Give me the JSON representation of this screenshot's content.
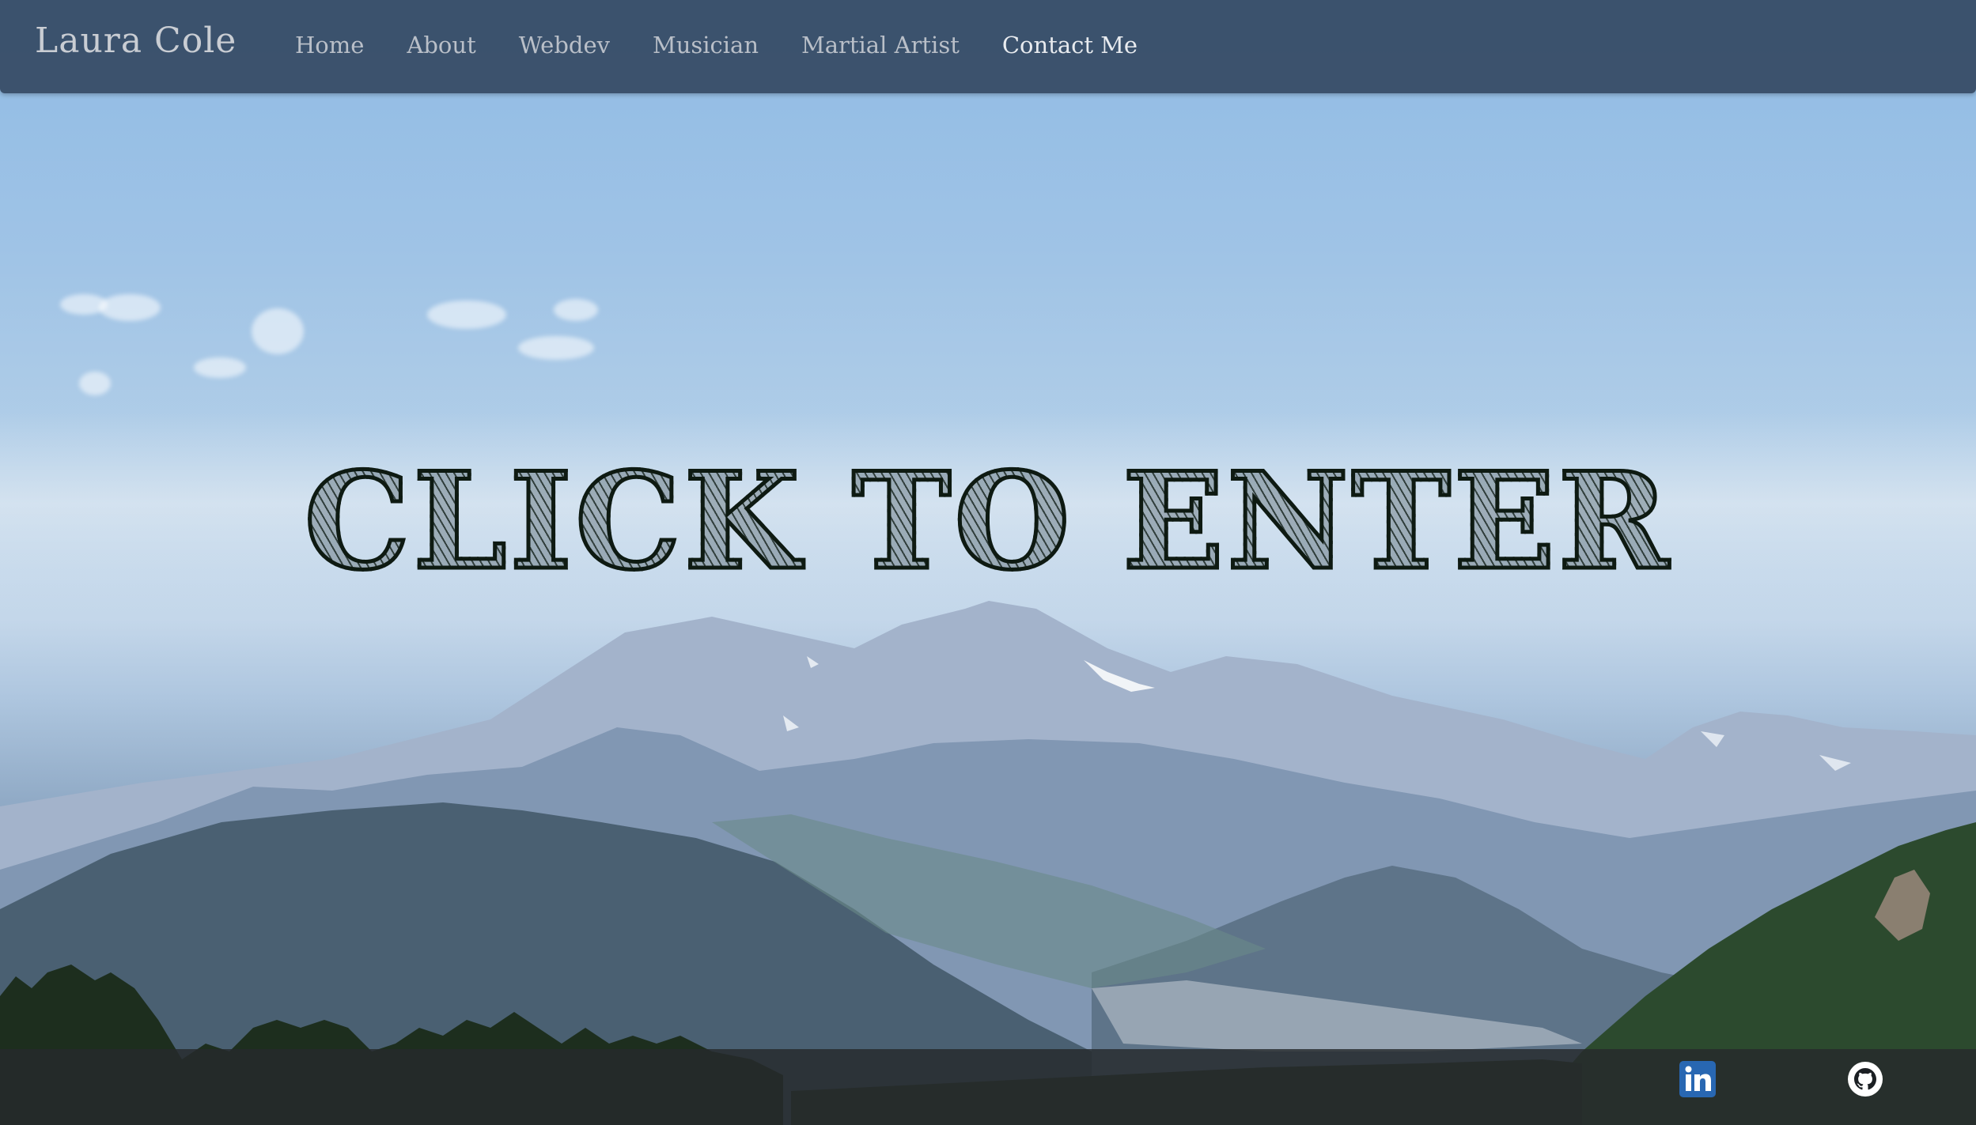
{
  "brand": {
    "name": "Laura Cole"
  },
  "nav": {
    "items": [
      {
        "label": "Home"
      },
      {
        "label": "About"
      },
      {
        "label": "Webdev"
      },
      {
        "label": "Musician"
      },
      {
        "label": "Martial Artist"
      },
      {
        "label": "Contact Me"
      }
    ]
  },
  "hero": {
    "cta": "CLICK TO ENTER"
  },
  "footer": {
    "social": [
      {
        "icon": "linkedin-icon",
        "color": "#2867b2"
      },
      {
        "icon": "github-icon",
        "color": "#ffffff"
      }
    ]
  },
  "colors": {
    "navbar": "#344963",
    "footer": "#262a2c",
    "cta_ink": "#0e1a12"
  }
}
